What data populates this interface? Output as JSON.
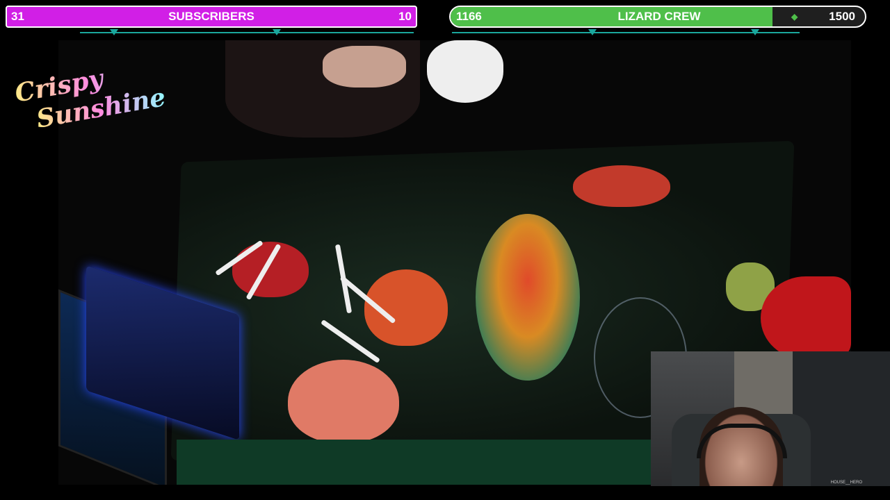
{
  "goals": {
    "subscribers": {
      "current": "31",
      "label": "SUBSCRIBERS",
      "target": "10",
      "color": "#d11fe6"
    },
    "lizard_crew": {
      "current": "1166",
      "label": "LIZARD CREW",
      "target": "1500",
      "progress_fraction": 0.777,
      "color": "#4fbf4a"
    }
  },
  "logo": {
    "line1": "Crispy",
    "line2": "Sunshine"
  },
  "facecam": {
    "tag": "HOUSE__HERO"
  },
  "colors": {
    "accent_teal": "#1aa79d",
    "background": "#000000"
  }
}
